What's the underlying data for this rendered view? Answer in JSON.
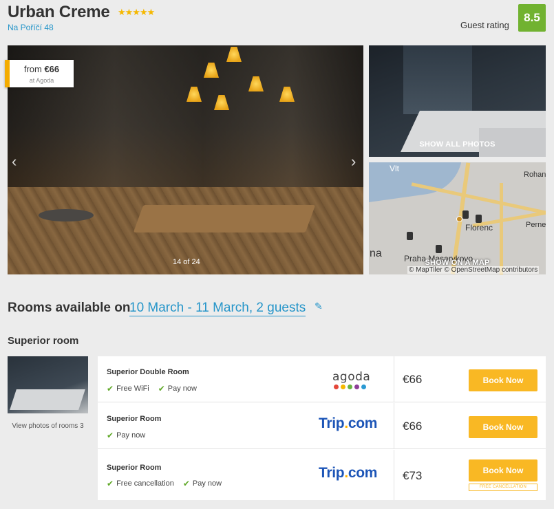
{
  "hotel": {
    "name": "Urban Creme",
    "stars": "★★★★★",
    "address": "Na Poříčí 48",
    "guest_rating_label": "Guest rating",
    "guest_rating": "8.5"
  },
  "gallery": {
    "price_prefix": "from",
    "price": "€66",
    "price_source": "at Agoda",
    "prev_arrow": "‹",
    "next_arrow": "›",
    "counter": "14 of 24",
    "show_all_photos": "SHOW ALL PHOTOS"
  },
  "map": {
    "labels": {
      "florenc": "Florenc",
      "praha_masarykovo": "Praha Masarykovo",
      "rohan": "Rohan",
      "perne": "Perne",
      "vlt": "Vlt",
      "na": "na"
    },
    "show_on_map": "SHOW ON A MAP",
    "copyright": "© MapTiler © OpenStreetMap contributors"
  },
  "rooms": {
    "heading": "Rooms available on",
    "dates": "10 March - 11 March, 2 guests",
    "edit_icon": "✎",
    "room_type": "Superior room",
    "view_photos": "View photos of rooms 3"
  },
  "offers": [
    {
      "name": "Superior Double Room",
      "features": [
        "Free WiFi",
        "Pay now"
      ],
      "provider": "agoda",
      "price": "€66",
      "button": "Book Now"
    },
    {
      "name": "Superior Room",
      "features": [
        "Pay now"
      ],
      "provider": "trip",
      "price": "€66",
      "button": "Book Now"
    },
    {
      "name": "Superior Room",
      "features": [
        "Free cancellation",
        "Pay now"
      ],
      "provider": "trip",
      "price": "€73",
      "button": "Book Now",
      "badge": "FREE CANCELLATION"
    }
  ],
  "logos": {
    "agoda": "agoda",
    "trip_a": "Trip",
    "trip_dot": ".",
    "trip_b": "com",
    "agoda_dot_colors": [
      "#e4473a",
      "#f5b800",
      "#69b342",
      "#8d3f97",
      "#2b9ad3"
    ]
  },
  "colors": {
    "accent_blue": "#2595c9",
    "rating_green": "#71b230",
    "button_yellow": "#f9b824",
    "check_green": "#5fa827"
  }
}
